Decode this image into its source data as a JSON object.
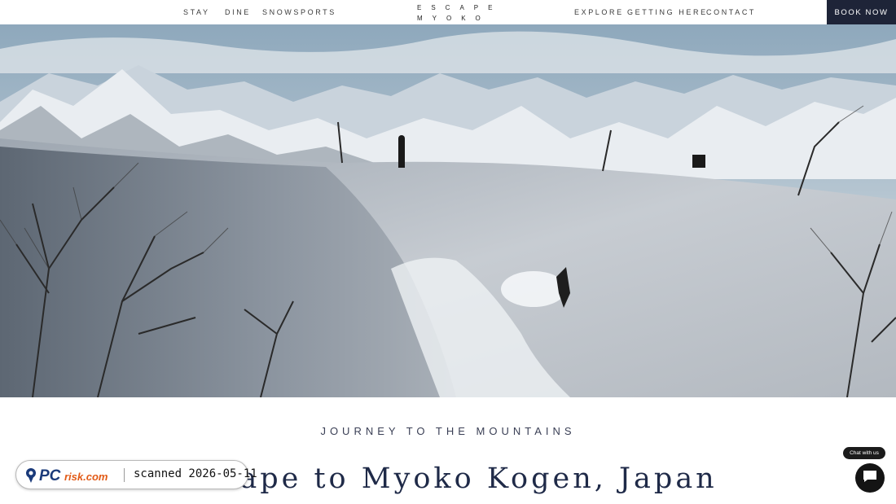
{
  "nav": {
    "left": [
      "STAY",
      "DINE",
      "SNOWSPORTS"
    ],
    "right": [
      "EXPLORE",
      "GETTING HERE",
      "CONTACT"
    ],
    "book_label": "BOOK NOW"
  },
  "logo": {
    "line1": "ESCAPE",
    "line2": "MYOKO"
  },
  "hero": {
    "image_desc_icon": "mountain-snowboarder-photo"
  },
  "content": {
    "kicker": "JOURNEY TO THE MOUNTAINS",
    "headline": "Escape to Myoko Kogen, Japan"
  },
  "scan_badge": {
    "brand": "PCrisk.com",
    "text": "scanned 2026-05-11"
  },
  "chat": {
    "label": "Chat with us",
    "icon": "chat-bubble-icon"
  },
  "colors": {
    "book_button_bg": "#1e2438",
    "headline": "#1f2a48",
    "chat_bg": "#141414"
  }
}
